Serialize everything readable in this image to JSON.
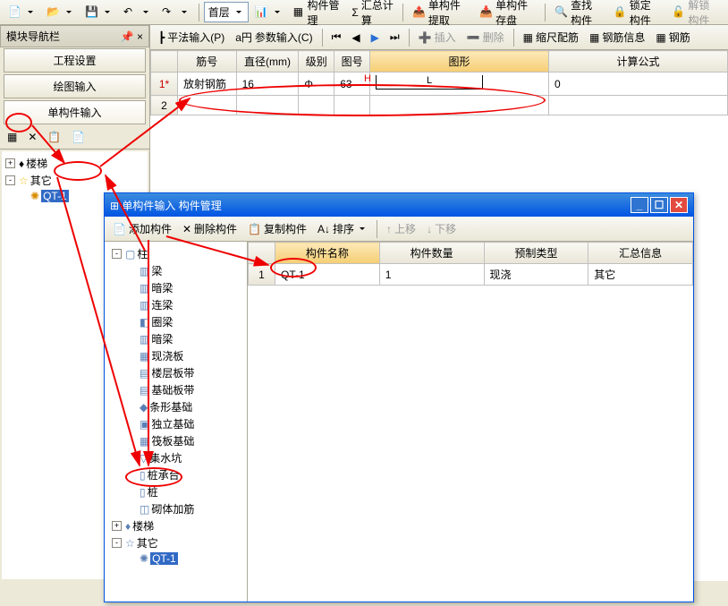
{
  "toolbar1": {
    "floor": "首层",
    "btns": [
      "构件管理",
      "汇总计算",
      "单构件提取",
      "单构件存盘",
      "查找构件",
      "锁定构件",
      "解锁构件"
    ]
  },
  "toolbar2": {
    "btns": [
      "平法输入(P)",
      "参数输入(C)",
      "插入",
      "删除",
      "缩尺配筋",
      "钢筋信息",
      "钢筋"
    ]
  },
  "leftPanel": {
    "title": "模块导航栏",
    "tabs": [
      "工程设置",
      "绘图输入",
      "单构件输入"
    ],
    "tree": [
      {
        "exp": "+",
        "icon": "♦",
        "label": "楼梯"
      },
      {
        "exp": "-",
        "icon": "☆",
        "label": "其它"
      },
      {
        "exp": "",
        "icon": "✺",
        "label": "QT-1",
        "sel": true,
        "indent": 1
      }
    ]
  },
  "mainGrid": {
    "headers": [
      "",
      "筋号",
      "直径(mm)",
      "级别",
      "图号",
      "图形",
      "计算公式"
    ],
    "rows": [
      {
        "num": "1*",
        "data": [
          "放射钢筋",
          "16",
          "Φ",
          "63",
          "",
          "0"
        ]
      },
      {
        "num": "2",
        "data": [
          "",
          "",
          "",
          "",
          "",
          ""
        ]
      }
    ],
    "shapeLabel": "L"
  },
  "popup": {
    "title": "单构件输入 构件管理",
    "toolbar": [
      "添加构件",
      "删除构件",
      "复制构件",
      "排序",
      "上移",
      "下移"
    ],
    "tree": [
      {
        "exp": "-",
        "icon": "▢",
        "label": "柱",
        "indent": 0
      },
      {
        "icon": "▥",
        "label": "梁",
        "indent": 1
      },
      {
        "icon": "▥",
        "label": "暗梁",
        "indent": 1
      },
      {
        "icon": "▥",
        "label": "连梁",
        "indent": 1
      },
      {
        "icon": "◧",
        "label": "圈梁",
        "indent": 1
      },
      {
        "icon": "▥",
        "label": "暗梁",
        "indent": 1
      },
      {
        "icon": "▦",
        "label": "现浇板",
        "indent": 1
      },
      {
        "icon": "▤",
        "label": "楼层板带",
        "indent": 1
      },
      {
        "icon": "▤",
        "label": "基础板带",
        "indent": 1
      },
      {
        "icon": "◆",
        "label": "条形基础",
        "indent": 1
      },
      {
        "icon": "▣",
        "label": "独立基础",
        "indent": 1
      },
      {
        "icon": "▦",
        "label": "筏板基础",
        "indent": 1
      },
      {
        "icon": "▽",
        "label": "集水坑",
        "indent": 1
      },
      {
        "icon": "▯",
        "label": "桩承台",
        "indent": 1
      },
      {
        "icon": "▯",
        "label": "桩",
        "indent": 1
      },
      {
        "icon": "◫",
        "label": "砌体加筋",
        "indent": 1
      },
      {
        "exp": "+",
        "icon": "♦",
        "label": "楼梯",
        "indent": 0
      },
      {
        "exp": "-",
        "icon": "☆",
        "label": "其它",
        "indent": 0
      },
      {
        "icon": "✺",
        "label": "QT-1",
        "sel": true,
        "indent": 1
      }
    ],
    "grid": {
      "headers": [
        "",
        "构件名称",
        "构件数量",
        "预制类型",
        "汇总信息"
      ],
      "row": {
        "num": "1",
        "name": "QT-1",
        "qty": "1",
        "type": "现浇",
        "sum": "其它"
      }
    }
  }
}
